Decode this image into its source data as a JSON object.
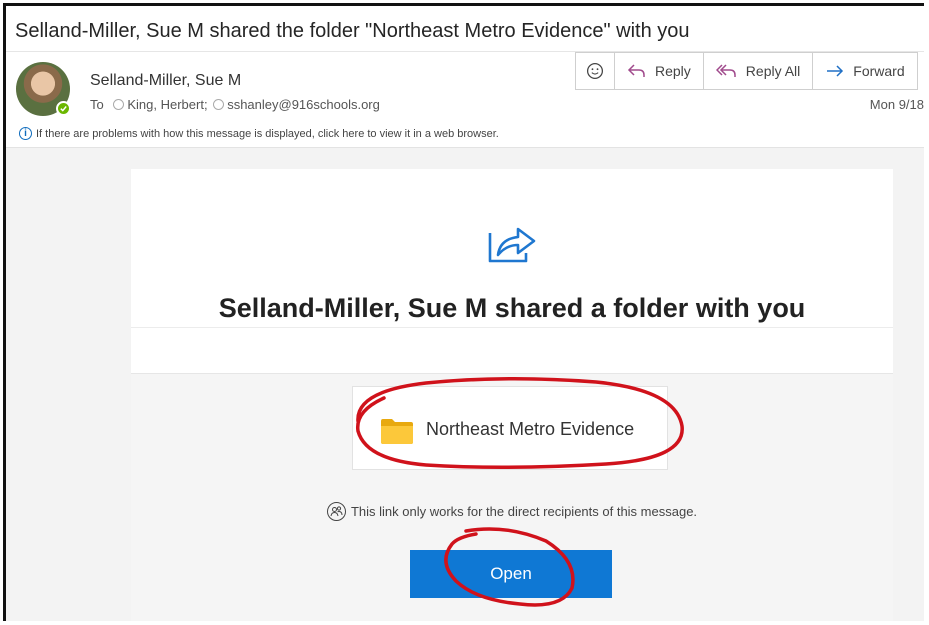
{
  "subject": "Selland-Miller, Sue M shared the folder \"Northeast Metro Evidence\" with you",
  "sender": {
    "name": "Selland-Miller, Sue M",
    "to_label": "To",
    "recipients": [
      "King, Herbert;",
      "sshanley@916schools.org"
    ],
    "date": "Mon 9/18"
  },
  "toolbar": {
    "reply": "Reply",
    "reply_all": "Reply All",
    "forward": "Forward"
  },
  "info_bar": "If there are problems with how this message is displayed, click here to view it in a web browser.",
  "card": {
    "title": "Selland-Miller, Sue M shared a folder with you",
    "folder_name": "Northeast Metro Evidence",
    "notice": "This link only works for the direct recipients of this message.",
    "open_label": "Open"
  },
  "icons": {
    "emoji": "smiley-icon",
    "reply": "reply-arrow-icon",
    "reply_all": "reply-all-arrow-icon",
    "forward": "forward-arrow-icon",
    "share": "share-icon",
    "folder": "folder-icon",
    "notice": "people-icon",
    "info": "info-icon"
  },
  "colors": {
    "accent_blue": "#0f78d4",
    "folder_yellow": "#f8c12c",
    "annotation_red": "#d0121b",
    "presence_green": "#6bb700"
  }
}
